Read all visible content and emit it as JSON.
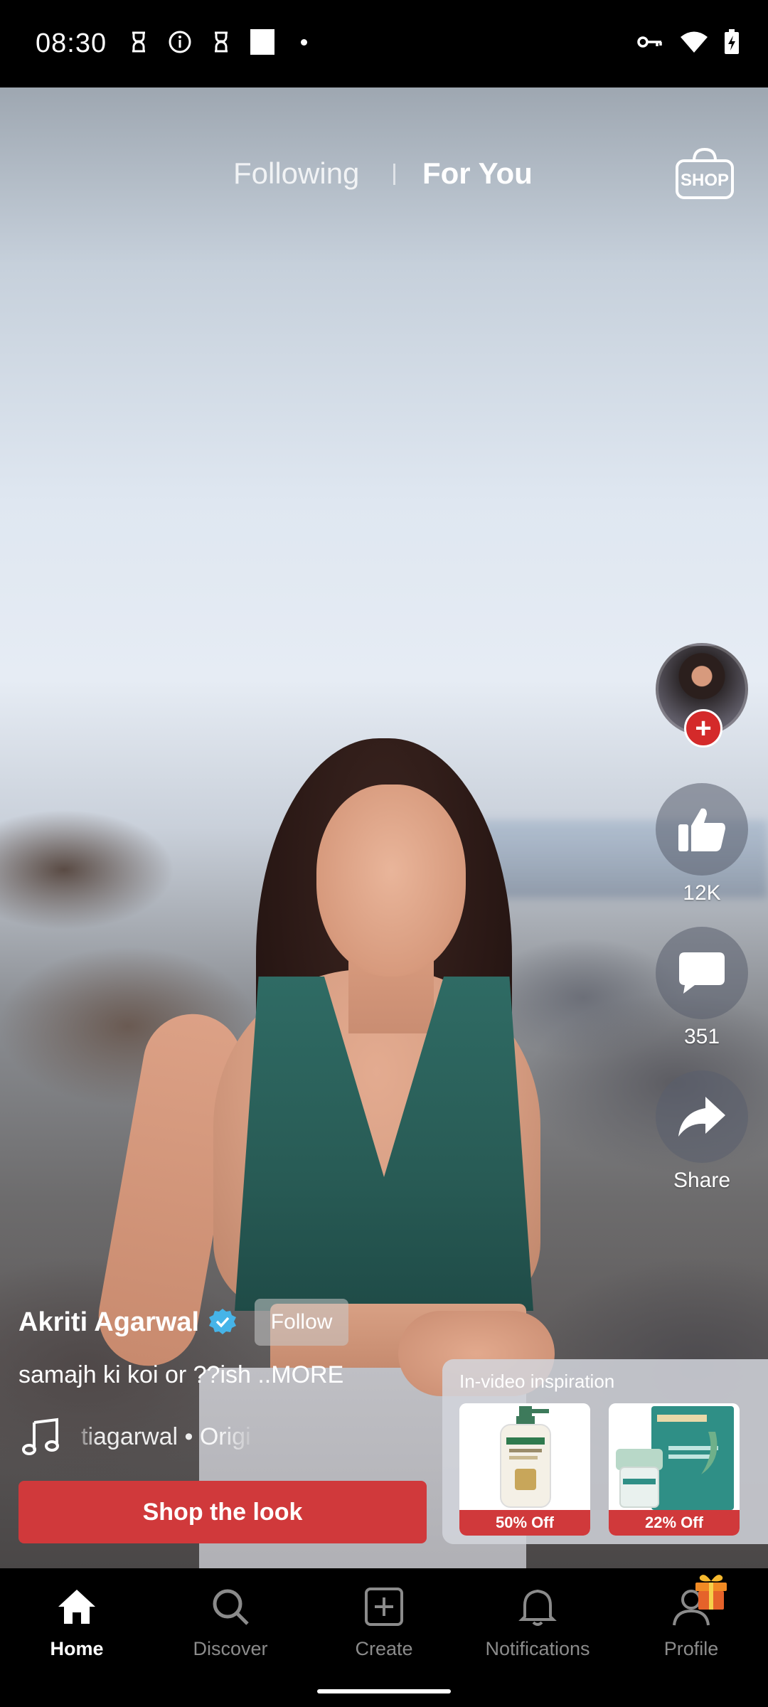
{
  "status_bar": {
    "time": "08:30"
  },
  "tabs": {
    "following": "Following",
    "for_you": "For You",
    "shop": "SHOP"
  },
  "rail": {
    "likes": "12K",
    "comments": "351",
    "share": "Share"
  },
  "post": {
    "creator": "Akriti Agarwal",
    "follow": "Follow",
    "caption": "samajh ki koi or ??ish ..MORE",
    "music": "tiagarwal • Original"
  },
  "shop_the_look": "Shop the look",
  "inspiration": {
    "title": "In-video inspiration",
    "items": [
      {
        "badge": "50% Off"
      },
      {
        "badge": "22% Off"
      }
    ]
  },
  "nav": {
    "home": "Home",
    "discover": "Discover",
    "create": "Create",
    "notifications": "Notifications",
    "profile": "Profile"
  },
  "colors": {
    "accent_red": "#d0393b",
    "verified_blue": "#46b4e8"
  }
}
